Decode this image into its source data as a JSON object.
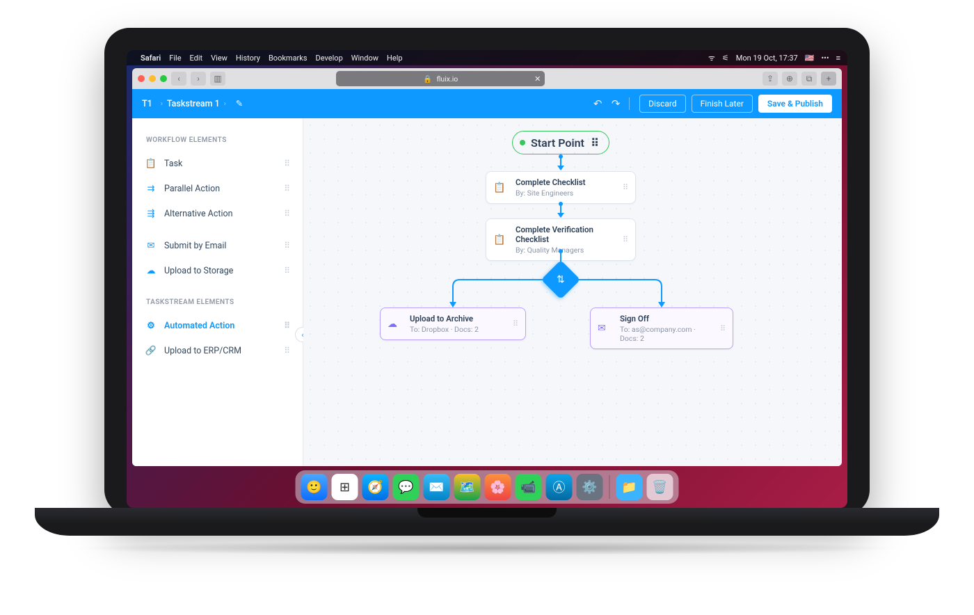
{
  "os": {
    "apple": "",
    "app_name": "Safari",
    "menus": [
      "File",
      "Edit",
      "View",
      "History",
      "Bookmarks",
      "Develop",
      "Window",
      "Help"
    ],
    "clock": "Mon 19 Oct, 17:37",
    "wifi": "⧉",
    "flag": "🇺🇸"
  },
  "browser": {
    "lock": "🔒",
    "url_display": "fluix.io"
  },
  "header": {
    "crumb_code": "T1",
    "title": "Taskstream 1",
    "discard": "Discard",
    "finish_later": "Finish Later",
    "save_publish": "Save & Publish"
  },
  "sidebar": {
    "section1": "WORKFLOW ELEMENTS",
    "section2": "TASKSTREAM ELEMENTS",
    "items1": [
      {
        "icon": "📋",
        "label": "Task"
      },
      {
        "icon": "⇉",
        "label": "Parallel Action"
      },
      {
        "icon": "⇶",
        "label": "Alternative Action"
      },
      {
        "icon": "✉",
        "label": "Submit by Email"
      },
      {
        "icon": "☁",
        "label": "Upload to Storage"
      }
    ],
    "items2": [
      {
        "icon": "⚙",
        "label": "Automated Action"
      },
      {
        "icon": "🔗",
        "label": "Upload to ERP/CRM"
      }
    ]
  },
  "flow": {
    "start": "Start Point",
    "n1": {
      "title": "Complete Checklist",
      "sub": "By: Site Engineers"
    },
    "n2": {
      "title": "Complete Verification Checklist",
      "sub": "By: Quality Managers"
    },
    "left": {
      "title": "Upload to Archive",
      "sub": "To: Dropbox  ·  Docs: 2"
    },
    "right": {
      "title": "Sign Off",
      "sub": "To: as@company.com  ·  Docs: 2"
    }
  }
}
